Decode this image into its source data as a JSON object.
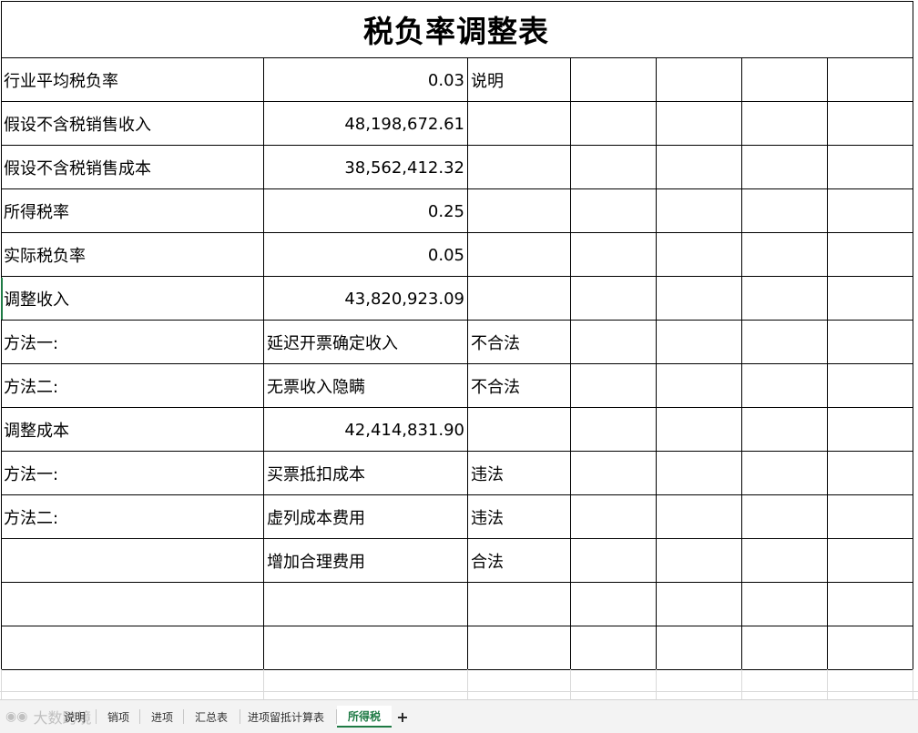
{
  "sheet": {
    "title": "税负率调整表",
    "rows": [
      {
        "a": "行业平均税负率",
        "b": "0.03",
        "b_align": "right",
        "c": "说明"
      },
      {
        "a": "假设不含税销售收入",
        "b": "48,198,672.61",
        "b_align": "right",
        "c": ""
      },
      {
        "a": "假设不含税销售成本",
        "b": "38,562,412.32",
        "b_align": "right",
        "c": ""
      },
      {
        "a": "所得税率",
        "b": "0.25",
        "b_align": "right",
        "c": ""
      },
      {
        "a": "实际税负率",
        "b": "0.05",
        "b_align": "right",
        "c": ""
      },
      {
        "a": "调整收入",
        "b": "43,820,923.09",
        "b_align": "right",
        "c": ""
      },
      {
        "a": "方法一:",
        "b": "延迟开票确定收入",
        "b_align": "left",
        "c": "不合法"
      },
      {
        "a": "方法二:",
        "b": "无票收入隐瞒",
        "b_align": "left",
        "c": "不合法"
      },
      {
        "a": "调整成本",
        "b": "42,414,831.90",
        "b_align": "right",
        "c": ""
      },
      {
        "a": "方法一:",
        "b": "买票抵扣成本",
        "b_align": "left",
        "c": "违法"
      },
      {
        "a": "方法二:",
        "b": "虚列成本费用",
        "b_align": "left",
        "c": "违法"
      },
      {
        "a": "",
        "b": "增加合理费用",
        "b_align": "left",
        "c": "合法"
      },
      {
        "a": "",
        "b": "",
        "b_align": "left",
        "c": ""
      },
      {
        "a": "",
        "b": "",
        "b_align": "left",
        "c": ""
      }
    ]
  },
  "tabs": {
    "items": [
      {
        "label": "说明",
        "active": false
      },
      {
        "label": "销项",
        "active": false
      },
      {
        "label": "进项",
        "active": false
      },
      {
        "label": "汇总表",
        "active": false
      },
      {
        "label": "进项留抵计算表",
        "active": false
      },
      {
        "label": "所得税",
        "active": true
      }
    ],
    "add_label": "+",
    "watermark": "大数跨境"
  },
  "colors": {
    "accent": "#1e7a44",
    "grid": "#000000",
    "light_grid": "#d9d9d9"
  }
}
